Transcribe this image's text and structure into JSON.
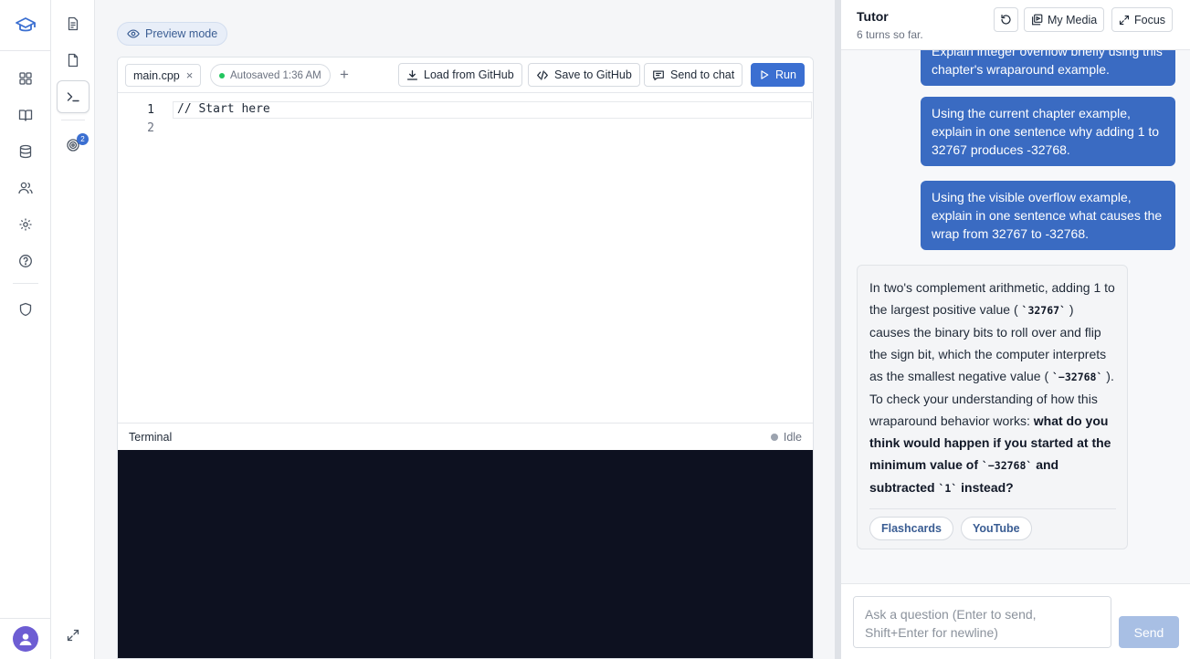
{
  "icons": {
    "logo": "graduation-cap-icon",
    "rail": [
      "dashboard-icon",
      "book-icon",
      "database-icon",
      "users-icon",
      "settings-icon",
      "help-icon",
      "shield-icon"
    ],
    "rail2": [
      "document-icon",
      "file-icon",
      "terminal-icon",
      "target-icon"
    ],
    "expand": "expand-icon"
  },
  "rail2": {
    "badge": "2"
  },
  "colors": {
    "accent": "#3b6fd1",
    "user_bubble": "#3a6bc2",
    "terminal_bg": "#0d1120",
    "avatar": "#6d5dd3"
  },
  "main": {
    "preview_label": "Preview mode"
  },
  "editor": {
    "file_tab": "main.cpp",
    "close_glyph": "×",
    "autosave": "Autosaved 1:36 AM",
    "add_glyph": "+",
    "buttons": {
      "load": "Load from GitHub",
      "save": "Save to GitHub",
      "send": "Send to chat",
      "run": "Run"
    },
    "line_numbers": [
      "1",
      "2"
    ],
    "code": "// Start here"
  },
  "terminal": {
    "title": "Terminal",
    "status": "Idle"
  },
  "tutor": {
    "title": "Tutor",
    "subtitle": "6 turns so far.",
    "buttons": {
      "media": "My Media",
      "focus": "Focus"
    },
    "messages": [
      {
        "role": "user",
        "text": "Explain integer overflow briefly using this chapter's wraparound example."
      },
      {
        "role": "user",
        "text": "Using the current chapter example, explain in one sentence why adding 1 to 32767 produces -32768."
      },
      {
        "role": "user",
        "text": "Using the visible overflow example, explain in one sentence what causes the wrap from 32767 to -32768."
      }
    ],
    "reply": {
      "p1": "In two's complement arithmetic, adding 1 to the largest positive value ( ",
      "c1": "`32767`",
      "p2": " ) causes the binary bits to roll over and flip the sign bit, which the computer interprets as the smallest negative value ( ",
      "c2": "`−32768`",
      "p3": " ). To check your understanding of how this wraparound behavior works: ",
      "b1": "what do you think would happen if you started at the minimum value of ",
      "c3": "`−32768`",
      "b2": " and subtracted ",
      "c4": "`1`",
      "b3": " instead?"
    },
    "chips": [
      "Flashcards",
      "YouTube"
    ],
    "input_placeholder": "Ask a question (Enter to send, Shift+Enter for newline)",
    "send_label": "Send"
  }
}
